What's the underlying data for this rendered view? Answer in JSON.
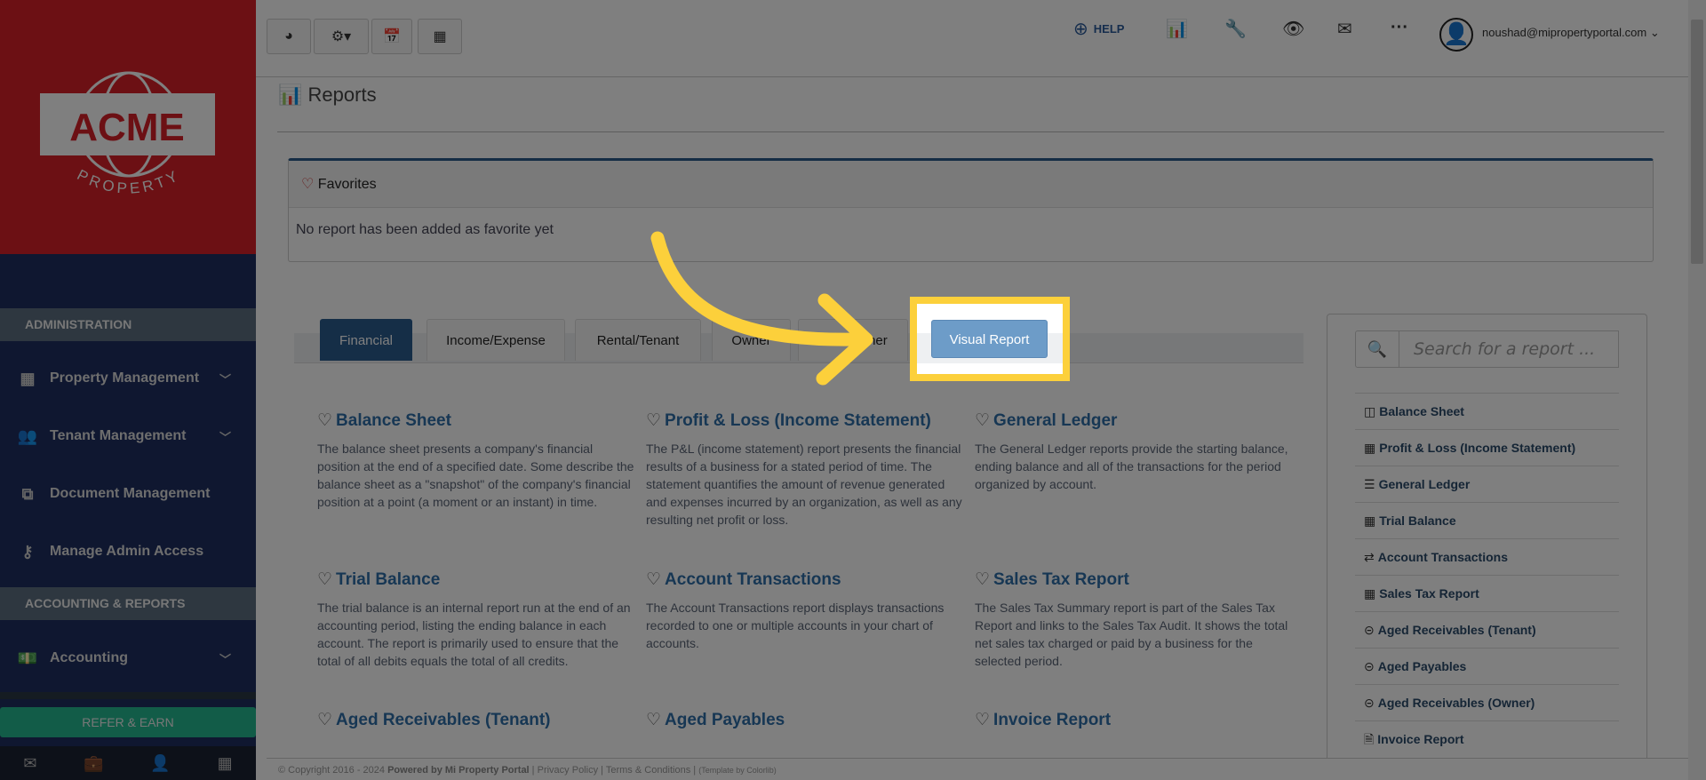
{
  "logo": {
    "word": "ACME",
    "sub": "PROPERTY"
  },
  "sidebar": {
    "sections": [
      {
        "label": "ADMINISTRATION"
      },
      {
        "label": "ACCOUNTING & REPORTS"
      }
    ],
    "items": [
      {
        "label": "Property Management",
        "icon": "building-icon"
      },
      {
        "label": "Tenant Management",
        "icon": "users-icon"
      },
      {
        "label": "Document Management",
        "icon": "documents-icon"
      },
      {
        "label": "Manage Admin Access",
        "icon": "key-icon"
      },
      {
        "label": "Accounting",
        "icon": "money-icon"
      }
    ],
    "refer": "REFER & EARN"
  },
  "topbar": {
    "help": "HELP",
    "user_email": "noushad@mipropertyportal.com"
  },
  "page": {
    "title": "Reports"
  },
  "favorites": {
    "title": "Favorites",
    "empty": "No report has been added as favorite yet"
  },
  "tabs": [
    {
      "label": "Financial",
      "active": true
    },
    {
      "label": "Income/Expense"
    },
    {
      "label": "Rental/Tenant"
    },
    {
      "label": "Owner"
    },
    {
      "label": "Other"
    },
    {
      "label": "Visual Report"
    }
  ],
  "reports": [
    {
      "title": "Balance Sheet",
      "desc": "The balance sheet presents a company's financial position at the end of a specified date. Some describe the balance sheet as a \"snapshot\" of the company's financial position at a point (a moment or an instant) in time."
    },
    {
      "title": "Profit & Loss (Income Statement)",
      "desc": "The P&L (income statement) report presents the financial results of a business for a stated period of time. The statement quantifies the amount of revenue generated and expenses incurred by an organization, as well as any resulting net profit or loss."
    },
    {
      "title": "General Ledger",
      "desc": "The General Ledger reports provide the starting balance, ending balance and all of the transactions for the period organized by account."
    },
    {
      "title": "Trial Balance",
      "desc": "The trial balance is an internal report run at the end of an accounting period, listing the ending balance in each account. The report is primarily used to ensure that the total of all debits equals the total of all credits."
    },
    {
      "title": "Account Transactions",
      "desc": "The Account Transactions report displays transactions recorded to one or multiple accounts in your chart of accounts."
    },
    {
      "title": "Sales Tax Report",
      "desc": "The Sales Tax Summary report is part of the Sales Tax Report and links to the Sales Tax Audit. It shows the total net sales tax charged or paid by a business for the selected period."
    },
    {
      "title": "Aged Receivables (Tenant)"
    },
    {
      "title": "Aged Payables"
    },
    {
      "title": "Invoice Report"
    }
  ],
  "search": {
    "placeholder": "Search for a report ..."
  },
  "report_list": [
    {
      "label": "Balance Sheet",
      "icon": "columns-icon",
      "glyph": "◫"
    },
    {
      "label": "Profit & Loss (Income Statement)",
      "icon": "calculator-icon",
      "glyph": "▦"
    },
    {
      "label": "General Ledger",
      "icon": "list-icon",
      "glyph": "☰"
    },
    {
      "label": "Trial Balance",
      "icon": "calendar-icon",
      "glyph": "▦"
    },
    {
      "label": "Account Transactions",
      "icon": "exchange-icon",
      "glyph": "⇄"
    },
    {
      "label": "Sales Tax Report",
      "icon": "calculator-icon",
      "glyph": "▦"
    },
    {
      "label": "Aged Receivables (Tenant)",
      "icon": "circle-arrow-right-icon",
      "glyph": "⊝"
    },
    {
      "label": "Aged Payables",
      "icon": "circle-arrow-left-icon",
      "glyph": "⊝"
    },
    {
      "label": "Aged Receivables (Owner)",
      "icon": "circle-arrow-right-icon",
      "glyph": "⊝"
    },
    {
      "label": "Invoice Report",
      "icon": "file-code-icon",
      "glyph": "🗎"
    }
  ],
  "footer": {
    "copyright": "© Copyright 2016 - 2024",
    "powered": "Powered by Mi Property Portal",
    "privacy": "Privacy Policy",
    "terms": "Terms & Conditions",
    "template": "(Template by Colorlib)"
  },
  "colors": {
    "brand_red": "#d92028",
    "navy": "#1e2e60",
    "highlight": "#fcd03b",
    "active_tab": "#2b5d8f"
  }
}
